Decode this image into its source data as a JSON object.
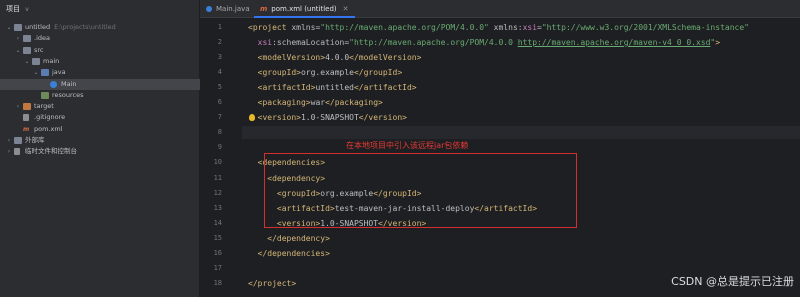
{
  "project_panel": {
    "title": "项目",
    "chevron": "v",
    "tree": [
      {
        "label": "untitled",
        "path": "E:\\projects\\untitled",
        "icon": "folder",
        "expanded": true,
        "indent": 0
      },
      {
        "label": ".idea",
        "icon": "folder",
        "expanded": false,
        "indent": 1
      },
      {
        "label": "src",
        "icon": "folder",
        "expanded": true,
        "indent": 1
      },
      {
        "label": "main",
        "icon": "folder",
        "expanded": true,
        "indent": 2
      },
      {
        "label": "java",
        "icon": "folder-src",
        "expanded": true,
        "indent": 3
      },
      {
        "label": "Main",
        "icon": "class",
        "indent": 4,
        "selected": true
      },
      {
        "label": "resources",
        "icon": "folder-res",
        "indent": 3
      },
      {
        "label": "target",
        "icon": "folder-target",
        "expanded": false,
        "indent": 1
      },
      {
        "label": ".gitignore",
        "icon": "file",
        "indent": 1
      },
      {
        "label": "pom.xml",
        "icon": "maven",
        "indent": 1
      },
      {
        "label": "外部库",
        "icon": "library",
        "expanded": false,
        "indent": 0
      },
      {
        "label": "临时文件和控制台",
        "icon": "scratch",
        "expanded": false,
        "indent": 0
      }
    ]
  },
  "tabs": [
    {
      "label": "Main.java",
      "icon": "class",
      "active": false
    },
    {
      "label": "pom.xml (untitled)",
      "icon": "maven",
      "active": true
    }
  ],
  "editor": {
    "line_numbers": [
      "1",
      "2",
      "3",
      "4",
      "5",
      "6",
      "7",
      "8",
      "9",
      "10",
      "11",
      "12",
      "13",
      "14",
      "15",
      "16",
      "17",
      "18"
    ],
    "current_line": 8,
    "code": [
      [
        {
          "t": "<project ",
          "c": "t"
        },
        {
          "t": "xmlns",
          "c": "a"
        },
        {
          "t": "=",
          "c": ""
        },
        {
          "t": "\"http://maven.apache.org/POM/4.0.0\"",
          "c": "s"
        },
        {
          "t": " xmlns:",
          "c": "a"
        },
        {
          "t": "xsi",
          "c": "ns"
        },
        {
          "t": "=",
          "c": ""
        },
        {
          "t": "\"http://www.w3.org/2001/XMLSchema-instance\"",
          "c": "s"
        }
      ],
      [
        {
          "t": "  ",
          "c": ""
        },
        {
          "t": "xsi",
          "c": "ns"
        },
        {
          "t": ":schemaLocation",
          "c": "a"
        },
        {
          "t": "=",
          "c": ""
        },
        {
          "t": "\"http://maven.apache.org/POM/4.0.0 ",
          "c": "s"
        },
        {
          "t": "http://maven.apache.org/maven-v4_0_0.xsd",
          "c": "s u"
        },
        {
          "t": "\"",
          "c": "s"
        },
        {
          "t": ">",
          "c": "t"
        }
      ],
      [
        {
          "t": "  <modelVersion>",
          "c": "t"
        },
        {
          "t": "4.0.0",
          "c": ""
        },
        {
          "t": "</modelVersion>",
          "c": "t"
        }
      ],
      [
        {
          "t": "  <groupId>",
          "c": "t"
        },
        {
          "t": "org.example",
          "c": ""
        },
        {
          "t": "</groupId>",
          "c": "t"
        }
      ],
      [
        {
          "t": "  <artifactId>",
          "c": "t"
        },
        {
          "t": "untitled",
          "c": ""
        },
        {
          "t": "</artifactId>",
          "c": "t"
        }
      ],
      [
        {
          "t": "  <packaging>",
          "c": "t"
        },
        {
          "t": "war",
          "c": ""
        },
        {
          "t": "</packaging>",
          "c": "t"
        }
      ],
      [
        {
          "t": "  <version>",
          "c": "t"
        },
        {
          "t": "1.0-SNAPSHOT",
          "c": ""
        },
        {
          "t": "</version>",
          "c": "t"
        }
      ],
      [],
      [],
      [
        {
          "t": "  <dependencies>",
          "c": "t"
        }
      ],
      [
        {
          "t": "    <dependency>",
          "c": "t"
        }
      ],
      [
        {
          "t": "      <groupId>",
          "c": "t"
        },
        {
          "t": "org.example",
          "c": ""
        },
        {
          "t": "</groupId>",
          "c": "t"
        }
      ],
      [
        {
          "t": "      <artifactId>",
          "c": "t"
        },
        {
          "t": "test-maven-jar-install-deploy",
          "c": ""
        },
        {
          "t": "</artifactId>",
          "c": "t"
        }
      ],
      [
        {
          "t": "      <version>",
          "c": "t"
        },
        {
          "t": "1.0-SNAPSHOT",
          "c": ""
        },
        {
          "t": "</version>",
          "c": "t"
        }
      ],
      [
        {
          "t": "    </dependency>",
          "c": "t"
        }
      ],
      [
        {
          "t": "  </dependencies>",
          "c": "t"
        }
      ],
      [],
      [
        {
          "t": "</project>",
          "c": "t"
        }
      ]
    ]
  },
  "annotation": {
    "text": "在本地项目中引入该远程jar包依赖",
    "color": "#e53935"
  },
  "watermark": "CSDN @总是提示已注册",
  "colors": {
    "tag": "#d5b778",
    "string": "#6aab73",
    "namespace": "#c77dbb",
    "accent": "#3574f0",
    "annotation_box": "#d32f2f"
  }
}
